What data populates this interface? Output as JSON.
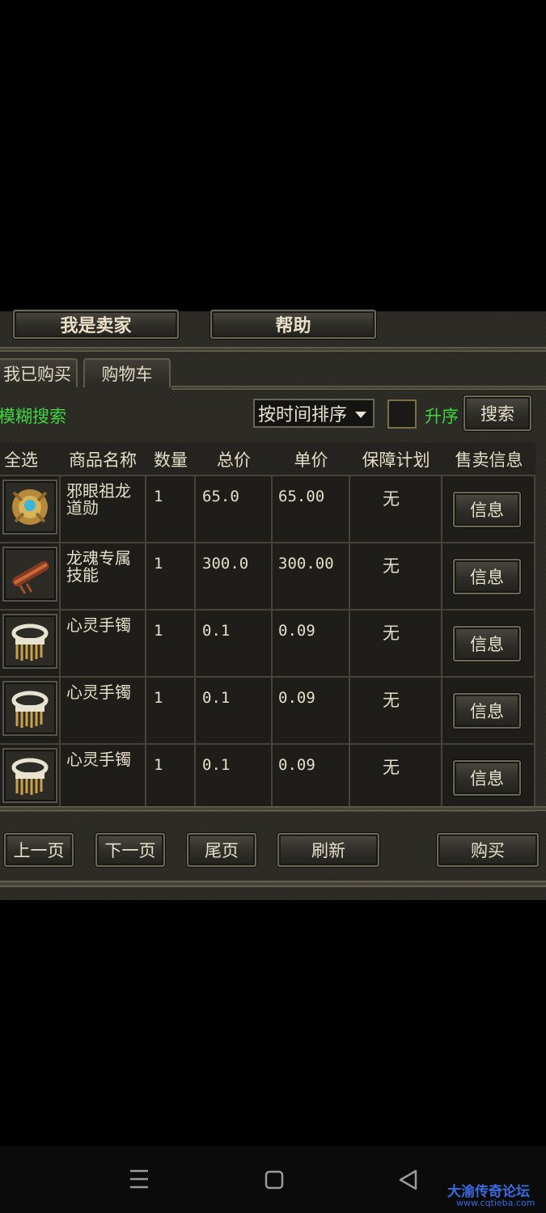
{
  "top_buttons": {
    "seller": "我是卖家",
    "help": "帮助"
  },
  "tabs": [
    "我已购买",
    "购物车"
  ],
  "search": {
    "fuzzy_label": "模糊搜索",
    "sort_value": "按时间排序",
    "ascending_label": "升序",
    "search_button": "搜索"
  },
  "table": {
    "headers": [
      "全选",
      "商品名称",
      "数量",
      "总价",
      "单价",
      "保障计划",
      "售卖信息"
    ],
    "rows": [
      {
        "name": "邪眼祖龙道勋",
        "qty": "1",
        "total": "65.0",
        "unit": "65.00",
        "guarantee": "无",
        "info": "信息",
        "icon": "golden-amulet-icon"
      },
      {
        "name": "龙魂专属技能",
        "qty": "1",
        "total": "300.0",
        "unit": "300.00",
        "guarantee": "无",
        "info": "信息",
        "icon": "scroll-icon"
      },
      {
        "name": "心灵手镯",
        "qty": "1",
        "total": "0.1",
        "unit": "0.09",
        "guarantee": "无",
        "info": "信息",
        "icon": "bracelet-icon"
      },
      {
        "name": "心灵手镯",
        "qty": "1",
        "total": "0.1",
        "unit": "0.09",
        "guarantee": "无",
        "info": "信息",
        "icon": "bracelet-icon"
      },
      {
        "name": "心灵手镯",
        "qty": "1",
        "total": "0.1",
        "unit": "0.09",
        "guarantee": "无",
        "info": "信息",
        "icon": "bracelet-icon"
      }
    ]
  },
  "pagination": {
    "prev": "上一页",
    "next": "下一页",
    "last": "尾页",
    "refresh": "刷新",
    "buy": "购买"
  },
  "watermark": {
    "title": "大渝传奇论坛",
    "url": "www.cqtieba.com"
  },
  "colors": {
    "accent_green": "#3fd63f",
    "panel_bg": "#2b2a24",
    "watermark_blue": "#3a6be0"
  }
}
